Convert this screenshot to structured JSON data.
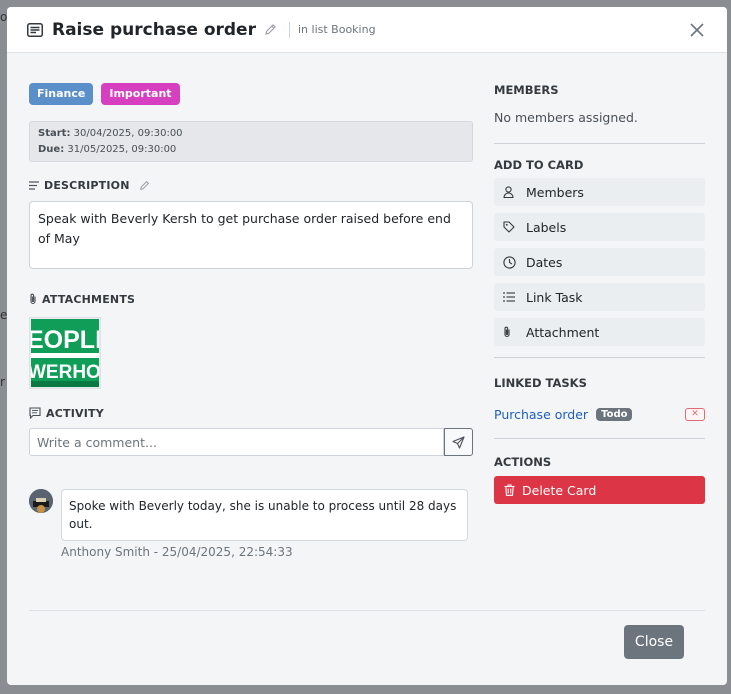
{
  "modal": {
    "title": "Raise purchase order",
    "list_label": "in list Booking",
    "icons": {
      "header": "card-icon",
      "edit": "pencil-icon",
      "close": "close-icon"
    }
  },
  "labels": [
    {
      "text": "Finance",
      "color": "#5b8fc9"
    },
    {
      "text": "Important",
      "color": "#d63fbf"
    }
  ],
  "dates": {
    "start_label": "Start:",
    "start_value": "30/04/2025, 09:30:00",
    "due_label": "Due:",
    "due_value": "31/05/2025, 09:30:00"
  },
  "description": {
    "heading": "DESCRIPTION",
    "text": "Speak with Beverly Kersh to get purchase order raised before end of May"
  },
  "attachments": {
    "heading": "ATTACHMENTS",
    "thumb_text_1": "EOPLE",
    "thumb_text_2": "WERHOU"
  },
  "activity": {
    "heading": "ACTIVITY",
    "comment_placeholder": "Write a comment...",
    "comments": [
      {
        "text": "Spoke with Beverly today, she is unable to process until 28 days out.",
        "meta": "Anthony Smith - 25/04/2025, 22:54:33"
      }
    ]
  },
  "sidebar": {
    "members_heading": "MEMBERS",
    "members_empty": "No members assigned.",
    "add_heading": "ADD TO CARD",
    "add_items": [
      {
        "label": "Members",
        "icon": "person-icon"
      },
      {
        "label": "Labels",
        "icon": "tag-icon"
      },
      {
        "label": "Dates",
        "icon": "clock-icon"
      },
      {
        "label": "Link Task",
        "icon": "list-icon"
      },
      {
        "label": "Attachment",
        "icon": "paperclip-icon"
      }
    ],
    "linked_heading": "LINKED TASKS",
    "linked_task": "Purchase order",
    "linked_status": "Todo",
    "actions_heading": "ACTIONS",
    "delete_label": "Delete Card"
  },
  "footer": {
    "close_label": "Close"
  },
  "background_fragments": [
    "o",
    "e",
    "r"
  ],
  "colors": {
    "danger": "#dc3545",
    "secondary": "#6c757d",
    "link": "#1f5fbf"
  }
}
